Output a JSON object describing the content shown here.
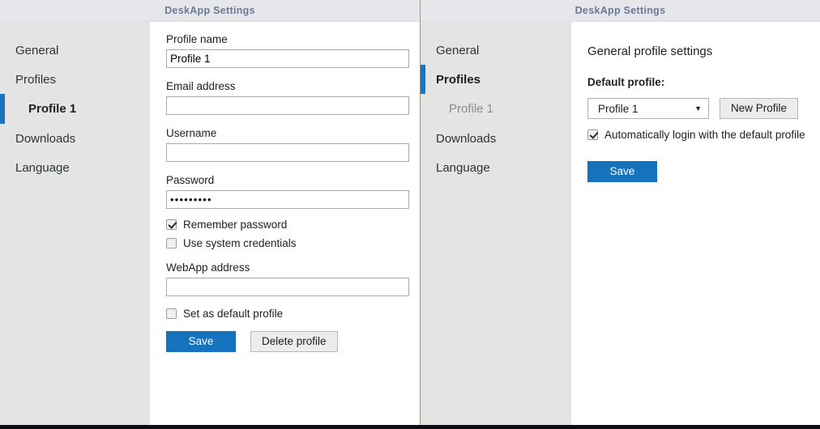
{
  "window_left": {
    "title": "DeskApp Settings",
    "sidebar": {
      "items": [
        {
          "label": "General",
          "state": "normal"
        },
        {
          "label": "Profiles",
          "state": "normal"
        },
        {
          "label": "Profile 1",
          "state": "active-sub"
        },
        {
          "label": "Downloads",
          "state": "normal"
        },
        {
          "label": "Language",
          "state": "normal"
        }
      ]
    },
    "form": {
      "profile_name_label": "Profile name",
      "profile_name_value": "Profile 1",
      "email_label": "Email address",
      "email_value": "",
      "email_placeholder": "",
      "username_label": "Username",
      "username_value": "",
      "username_placeholder": "",
      "password_label": "Password",
      "password_value": "•••••••••",
      "remember_password_label": "Remember password",
      "remember_password_checked": true,
      "use_system_credentials_label": "Use system credentials",
      "use_system_credentials_checked": false,
      "webapp_label": "WebApp address",
      "webapp_value": "",
      "webapp_placeholder": "",
      "set_default_label": "Set as default profile",
      "set_default_checked": false,
      "save_button": "Save",
      "delete_button": "Delete profile"
    }
  },
  "window_right": {
    "title": "DeskApp Settings",
    "sidebar": {
      "items": [
        {
          "label": "General",
          "state": "normal"
        },
        {
          "label": "Profiles",
          "state": "active"
        },
        {
          "label": "Profile 1",
          "state": "muted-sub"
        },
        {
          "label": "Downloads",
          "state": "normal"
        },
        {
          "label": "Language",
          "state": "normal"
        }
      ]
    },
    "panel": {
      "heading": "General profile settings",
      "default_profile_label": "Default profile:",
      "default_profile_selected": "Profile 1",
      "dropdown_arrow": "▼",
      "new_profile_button": "New Profile",
      "auto_login_label": "Automatically login with the default profile",
      "auto_login_checked": true,
      "save_button": "Save"
    }
  },
  "theme": {
    "accent_blue": "#1573be",
    "sidebar_bg": "#e4e4e4",
    "titlebar_bg": "#e5e7eb",
    "titlebar_text": "#6b7a96",
    "content_bg": "#ffffff",
    "footer_bar": "#0d0d14"
  }
}
